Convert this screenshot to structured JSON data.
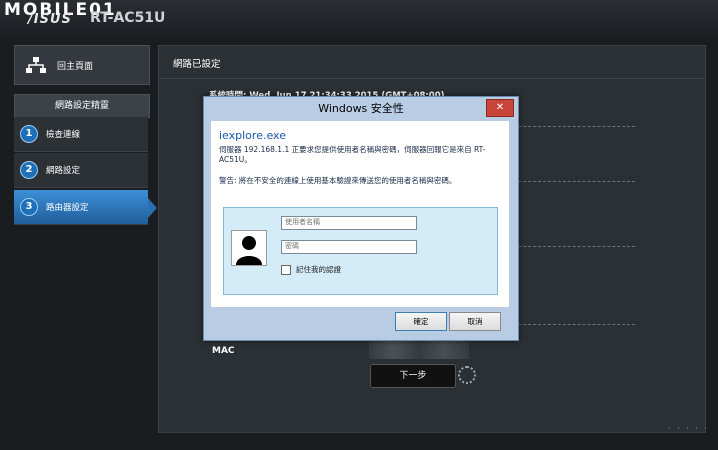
{
  "header": {
    "brand": "MOBILE01",
    "logo": "/ISUS",
    "model": "RT-AC51U"
  },
  "sidebar": {
    "home_label": "回主頁面",
    "wizard_title": "網路設定精靈",
    "items": [
      {
        "num": "1",
        "label": "檢查連線",
        "active": false
      },
      {
        "num": "2",
        "label": "網路設定",
        "active": false
      },
      {
        "num": "3",
        "label": "路由器設定",
        "active": true
      }
    ]
  },
  "main": {
    "title": "網路已設定",
    "system_time": "系統時間: Wed, Jun 17 21:34:33 2015 (GMT+08:00)",
    "mac_label": "MAC",
    "next_label": "下一步"
  },
  "dialog": {
    "title": "Windows 安全性",
    "close": "✕",
    "app": "iexplore.exe",
    "message": "伺服器 192.168.1.1 正要求您提供使用者名稱與密碼，伺服器回報它是來自 RT-AC51U。",
    "warning": "警告: 將在不安全的連線上使用基本驗證來傳送您的使用者名稱與密碼。",
    "username_placeholder": "使用者名稱",
    "password_placeholder": "密碼",
    "remember_label": "記住我的認證",
    "ok_label": "確定",
    "cancel_label": "取消"
  },
  "colors": {
    "accent": "#1f5e9a",
    "dialog_frame": "#b8cde3",
    "close_red": "#c9453a"
  }
}
